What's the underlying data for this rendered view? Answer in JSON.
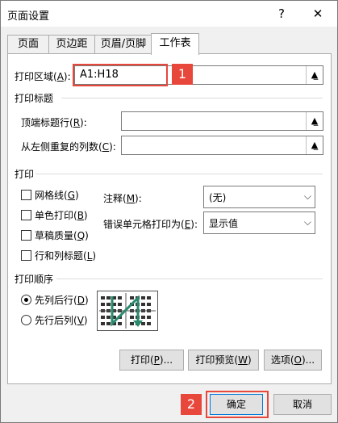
{
  "window": {
    "title": "页面设置",
    "help_icon": "?",
    "close_icon": "✕"
  },
  "tabs": [
    {
      "label": "页面"
    },
    {
      "label": "页边距"
    },
    {
      "label": "页眉/页脚"
    },
    {
      "label": "工作表"
    }
  ],
  "print_area": {
    "label_main": "打印区域(",
    "label_key": "A",
    "label_end": "):",
    "value": "A1:H18",
    "badge": "1"
  },
  "print_titles": {
    "section_label": "打印标题",
    "rows_label_main": "顶端标题行(",
    "rows_label_key": "R",
    "rows_label_end": "):",
    "rows_value": "",
    "cols_label_main": "从左侧重复的列数(",
    "cols_label_key": "C",
    "cols_label_end": "):",
    "cols_value": ""
  },
  "print": {
    "section_label": "打印",
    "gridlines": {
      "main": "网格线(",
      "key": "G",
      "end": ")",
      "checked": false
    },
    "bw": {
      "main": "单色打印(",
      "key": "B",
      "end": ")",
      "checked": false
    },
    "draft": {
      "main": "草稿质量(",
      "key": "Q",
      "end": ")",
      "checked": false
    },
    "headings": {
      "main": "行和列标题(",
      "key": "L",
      "end": ")",
      "checked": false
    },
    "comments_label_main": "注释(",
    "comments_label_key": "M",
    "comments_label_end": "):",
    "comments_value": "(无)",
    "errors_label_main": "错误单元格打印为(",
    "errors_label_key": "E",
    "errors_label_end": "):",
    "errors_value": "显示值"
  },
  "page_order": {
    "section_label": "打印顺序",
    "down_then_over": {
      "main": "先列后行(",
      "key": "D",
      "end": ")",
      "selected": true
    },
    "over_then_down": {
      "main": "先行后列(",
      "key": "V",
      "end": ")",
      "selected": false
    }
  },
  "panel_buttons": {
    "print": {
      "main": "打印(",
      "key": "P",
      "end": ")..."
    },
    "preview": {
      "main": "打印预览(",
      "key": "W",
      "end": ")"
    },
    "options": {
      "main": "选项(",
      "key": "O",
      "end": ")..."
    }
  },
  "footer": {
    "ok": "确定",
    "cancel": "取消",
    "badge": "2"
  },
  "colors": {
    "highlight": "#e8473c",
    "arrow": "#2a8a6e"
  },
  "icons": {
    "collapse": "collapse-dialog-icon",
    "dropdown": "chevron-down-icon"
  }
}
